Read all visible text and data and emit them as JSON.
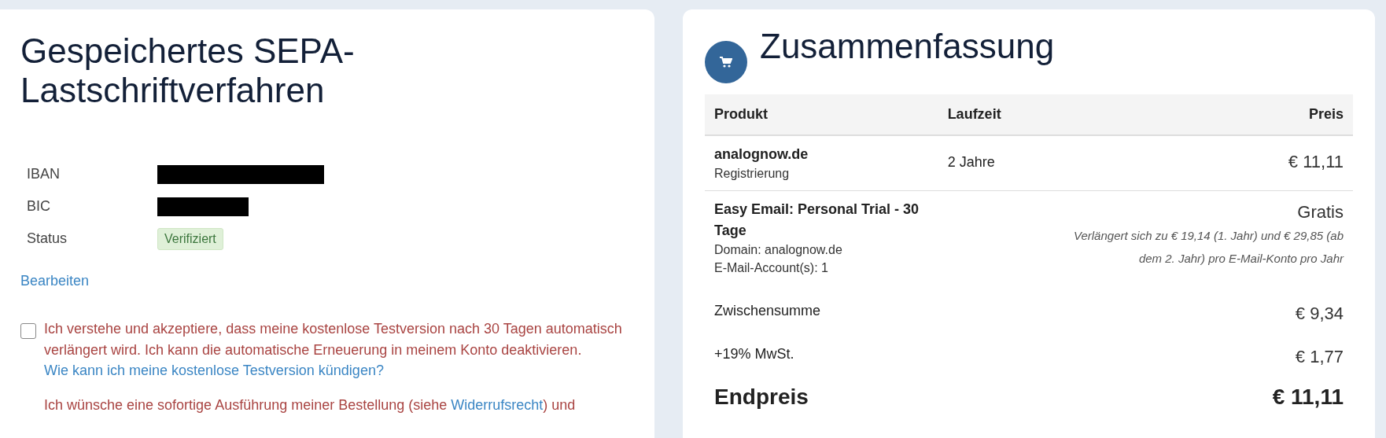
{
  "payment": {
    "title": "Gespeichertes SEPA-Lastschriftverfahren",
    "fields": [
      {
        "label": "IBAN",
        "kind": "redacted"
      },
      {
        "label": "BIC",
        "kind": "redacted"
      },
      {
        "label": "Status",
        "kind": "badge",
        "value": "Verifiziert",
        "color": "#dff0d8"
      }
    ],
    "edit_link": "Bearbeiten",
    "consents": [
      {
        "checked": false,
        "segments": [
          {
            "kind": "text",
            "text": "Ich verstehe und akzeptiere, dass meine kostenlose Testversion nach 30 Tagen automatisch verlängert wird. Ich kann die automatische Erneuerung in meinem Konto deaktivieren. "
          },
          {
            "kind": "link",
            "text": "Wie kann ich meine kostenlose Testversion kündigen?"
          }
        ]
      },
      {
        "segments": [
          {
            "kind": "text",
            "text": "Ich wünsche eine sofortige Ausführung meiner Bestellung (siehe "
          },
          {
            "kind": "link",
            "text": "Widerrufsrecht"
          },
          {
            "kind": "text",
            "text": ") und"
          }
        ]
      }
    ]
  },
  "summary": {
    "title": "Zusammenfassung",
    "columns": [
      "Produkt",
      "Laufzeit",
      "Preis"
    ],
    "items": [
      {
        "name": "analognow.de",
        "details": [
          "Registrierung"
        ],
        "term": "2 Jahre",
        "price": "€ 11,11"
      },
      {
        "name": "Easy Email: Personal Trial - 30 Tage",
        "details": [
          "Domain: analognow.de",
          "E-Mail-Account(s): 1"
        ],
        "price": "Gratis",
        "price_note": "Verlängert sich zu € 19,14 (1. Jahr) und € 29,85 (ab dem 2. Jahr) pro E-Mail-Konto pro Jahr"
      }
    ],
    "totals": [
      {
        "kind": "sub",
        "label": "Zwischensumme",
        "value": "€ 9,34"
      },
      {
        "kind": "sub",
        "label": "+19% MwSt.",
        "value": "€ 1,77"
      },
      {
        "kind": "grand",
        "label": "Endpreis",
        "value": "€ 11,11"
      }
    ]
  }
}
